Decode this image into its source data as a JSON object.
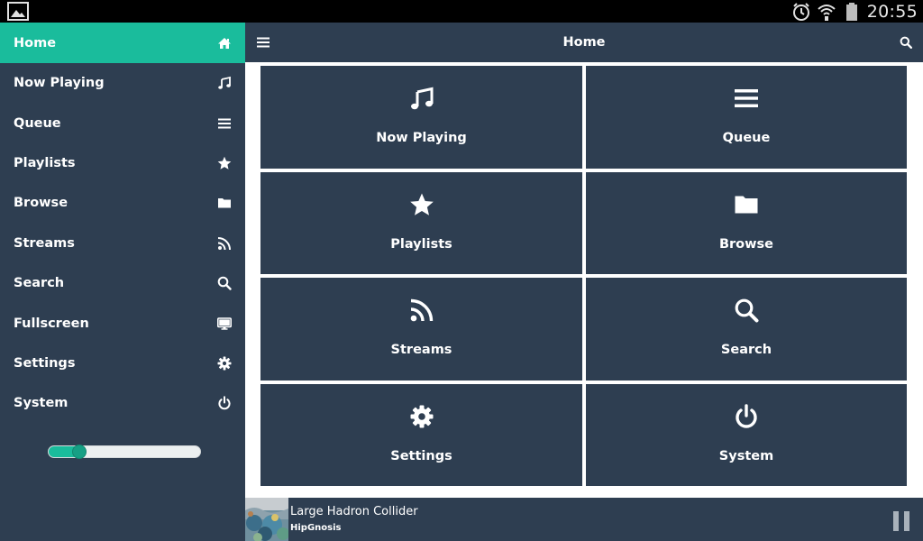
{
  "status_bar": {
    "time": "20:55"
  },
  "sidebar": {
    "items": [
      {
        "label": "Home",
        "icon": "home-icon",
        "active": true
      },
      {
        "label": "Now Playing",
        "icon": "music-note-icon"
      },
      {
        "label": "Queue",
        "icon": "list-icon"
      },
      {
        "label": "Playlists",
        "icon": "star-icon"
      },
      {
        "label": "Browse",
        "icon": "folder-icon"
      },
      {
        "label": "Streams",
        "icon": "rss-icon"
      },
      {
        "label": "Search",
        "icon": "search-icon"
      },
      {
        "label": "Fullscreen",
        "icon": "monitor-icon"
      },
      {
        "label": "Settings",
        "icon": "gear-icon"
      },
      {
        "label": "System",
        "icon": "power-icon"
      }
    ],
    "volume_level": 0.2
  },
  "topbar": {
    "title": "Home",
    "menu_icon": "menu-icon",
    "search_icon": "search-icon"
  },
  "tiles": [
    {
      "label": "Now Playing",
      "icon": "music-note-icon"
    },
    {
      "label": "Queue",
      "icon": "list-icon"
    },
    {
      "label": "Playlists",
      "icon": "star-icon"
    },
    {
      "label": "Browse",
      "icon": "folder-icon"
    },
    {
      "label": "Streams",
      "icon": "rss-icon"
    },
    {
      "label": "Search",
      "icon": "search-icon"
    },
    {
      "label": "Settings",
      "icon": "gear-icon"
    },
    {
      "label": "System",
      "icon": "power-icon"
    }
  ],
  "player": {
    "track_title": "Large Hadron Collider",
    "artist": "HipGnosis",
    "pause_icon": "pause-icon"
  },
  "colors": {
    "panel": "#2e3e51",
    "accent": "#1abc9c",
    "content_bg": "#ffffff"
  }
}
